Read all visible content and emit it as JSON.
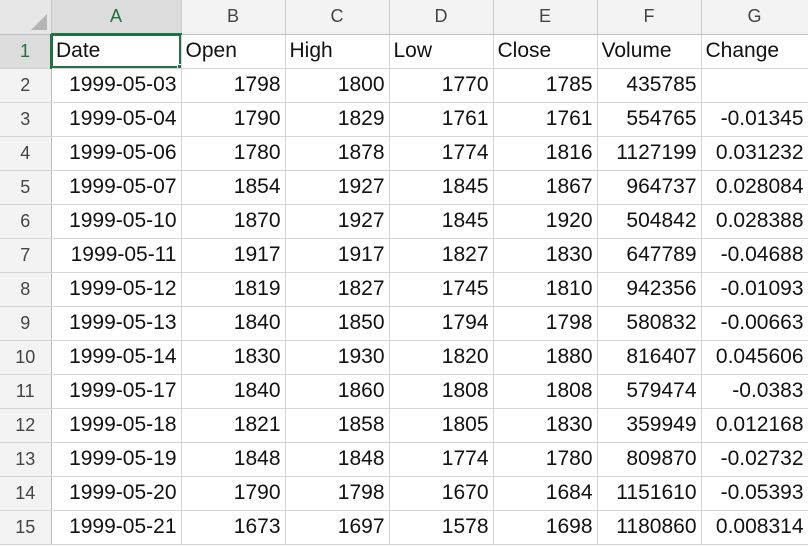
{
  "column_headers": [
    "A",
    "B",
    "C",
    "D",
    "E",
    "F",
    "G"
  ],
  "active_cell": "A1",
  "accent_color": "#217346",
  "corner_icon": "select-all-triangle",
  "rows": [
    {
      "row": "1",
      "cells": [
        "Date",
        "Open",
        "High",
        "Low",
        "Close",
        "Volume",
        "Change"
      ]
    },
    {
      "row": "2",
      "cells": [
        "1999-05-03",
        "1798",
        "1800",
        "1770",
        "1785",
        "435785",
        ""
      ]
    },
    {
      "row": "3",
      "cells": [
        "1999-05-04",
        "1790",
        "1829",
        "1761",
        "1761",
        "554765",
        "-0.01345"
      ]
    },
    {
      "row": "4",
      "cells": [
        "1999-05-06",
        "1780",
        "1878",
        "1774",
        "1816",
        "1127199",
        "0.031232"
      ]
    },
    {
      "row": "5",
      "cells": [
        "1999-05-07",
        "1854",
        "1927",
        "1845",
        "1867",
        "964737",
        "0.028084"
      ]
    },
    {
      "row": "6",
      "cells": [
        "1999-05-10",
        "1870",
        "1927",
        "1845",
        "1920",
        "504842",
        "0.028388"
      ]
    },
    {
      "row": "7",
      "cells": [
        "1999-05-11",
        "1917",
        "1917",
        "1827",
        "1830",
        "647789",
        "-0.04688"
      ]
    },
    {
      "row": "8",
      "cells": [
        "1999-05-12",
        "1819",
        "1827",
        "1745",
        "1810",
        "942356",
        "-0.01093"
      ]
    },
    {
      "row": "9",
      "cells": [
        "1999-05-13",
        "1840",
        "1850",
        "1794",
        "1798",
        "580832",
        "-0.00663"
      ]
    },
    {
      "row": "10",
      "cells": [
        "1999-05-14",
        "1830",
        "1930",
        "1820",
        "1880",
        "816407",
        "0.045606"
      ]
    },
    {
      "row": "11",
      "cells": [
        "1999-05-17",
        "1840",
        "1860",
        "1808",
        "1808",
        "579474",
        "-0.0383"
      ]
    },
    {
      "row": "12",
      "cells": [
        "1999-05-18",
        "1821",
        "1858",
        "1805",
        "1830",
        "359949",
        "0.012168"
      ]
    },
    {
      "row": "13",
      "cells": [
        "1999-05-19",
        "1848",
        "1848",
        "1774",
        "1780",
        "809870",
        "-0.02732"
      ]
    },
    {
      "row": "14",
      "cells": [
        "1999-05-20",
        "1790",
        "1798",
        "1670",
        "1684",
        "1151610",
        "-0.05393"
      ]
    },
    {
      "row": "15",
      "cells": [
        "1999-05-21",
        "1673",
        "1697",
        "1578",
        "1698",
        "1180860",
        "0.008314"
      ]
    }
  ]
}
